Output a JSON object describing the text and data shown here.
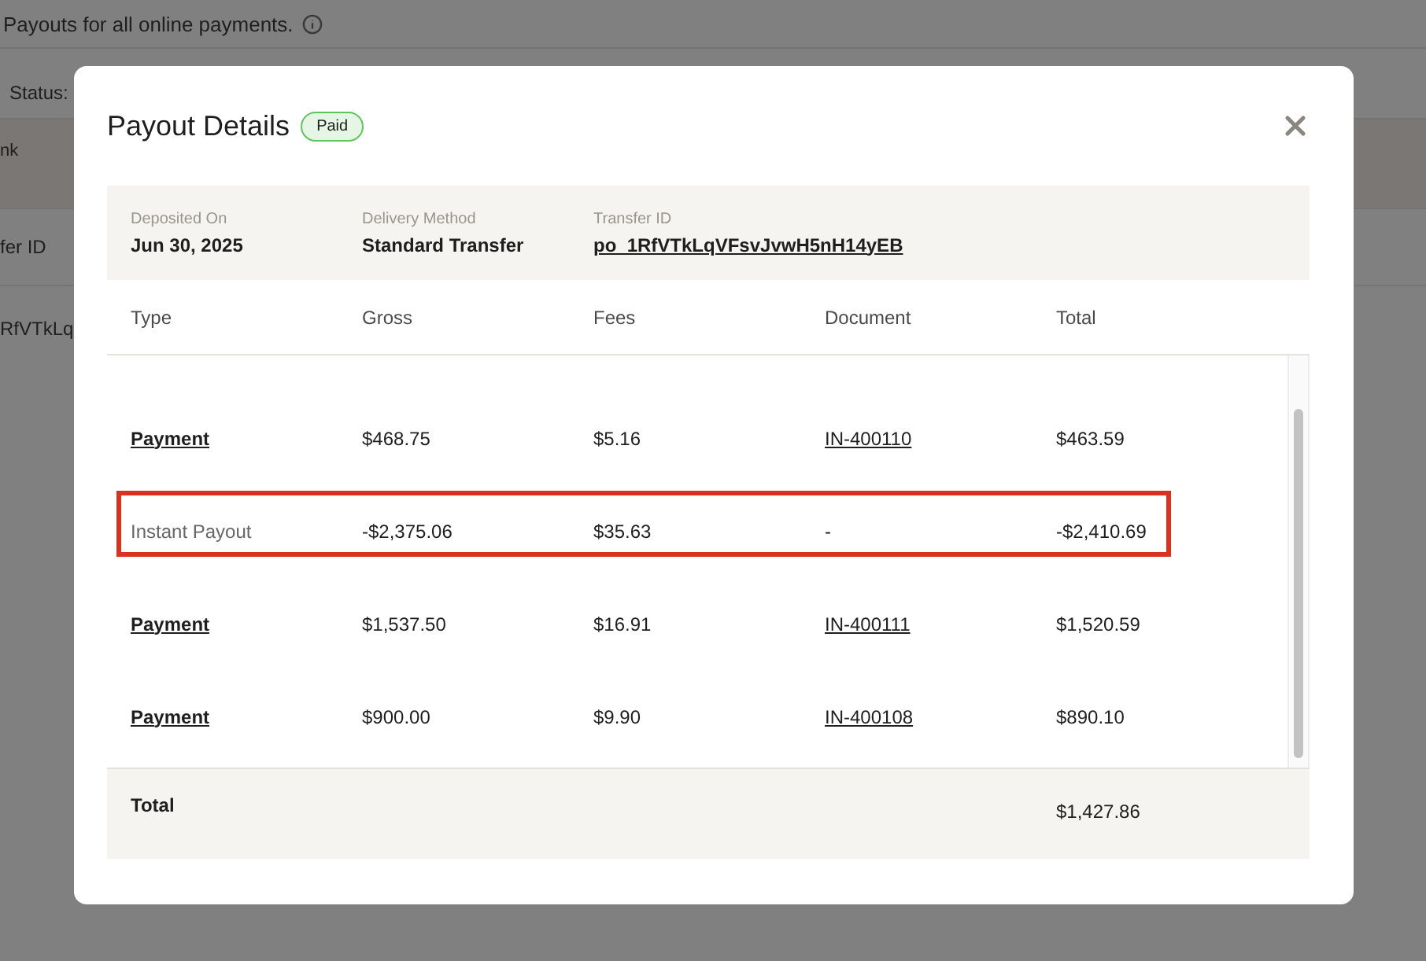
{
  "background": {
    "description": "Payouts for all online payments.",
    "filter_label": "Status:",
    "column_1": "nk",
    "column_2": "fer ID",
    "cell": "RfVTkLq"
  },
  "modal": {
    "title": "Payout Details",
    "status": "Paid",
    "summary": [
      {
        "label": "Deposited On",
        "value": "Jun 30, 2025",
        "link": false
      },
      {
        "label": "Delivery Method",
        "value": "Standard Transfer",
        "link": false
      },
      {
        "label": "Transfer ID",
        "value": "po_1RfVTkLqVFsvJvwH5nH14yEB",
        "link": true
      }
    ],
    "columns": [
      "Type",
      "Gross",
      "Fees",
      "Document",
      "Total"
    ],
    "rows": [
      {
        "type": "Payment",
        "type_link": true,
        "gross": "$468.75",
        "fees": "$5.16",
        "document": "IN-400110",
        "document_link": true,
        "total": "$463.59",
        "highlighted": false
      },
      {
        "type": "Instant Payout",
        "type_link": false,
        "gross": "-$2,375.06",
        "fees": "$35.63",
        "document": "-",
        "document_link": false,
        "total": "-$2,410.69",
        "highlighted": true
      },
      {
        "type": "Payment",
        "type_link": true,
        "gross": "$1,537.50",
        "fees": "$16.91",
        "document": "IN-400111",
        "document_link": true,
        "total": "$1,520.59",
        "highlighted": false
      },
      {
        "type": "Payment",
        "type_link": true,
        "gross": "$900.00",
        "fees": "$9.90",
        "document": "IN-400108",
        "document_link": true,
        "total": "$890.10",
        "highlighted": false
      }
    ],
    "footer": {
      "label": "Total",
      "total": "$1,427.86"
    }
  }
}
